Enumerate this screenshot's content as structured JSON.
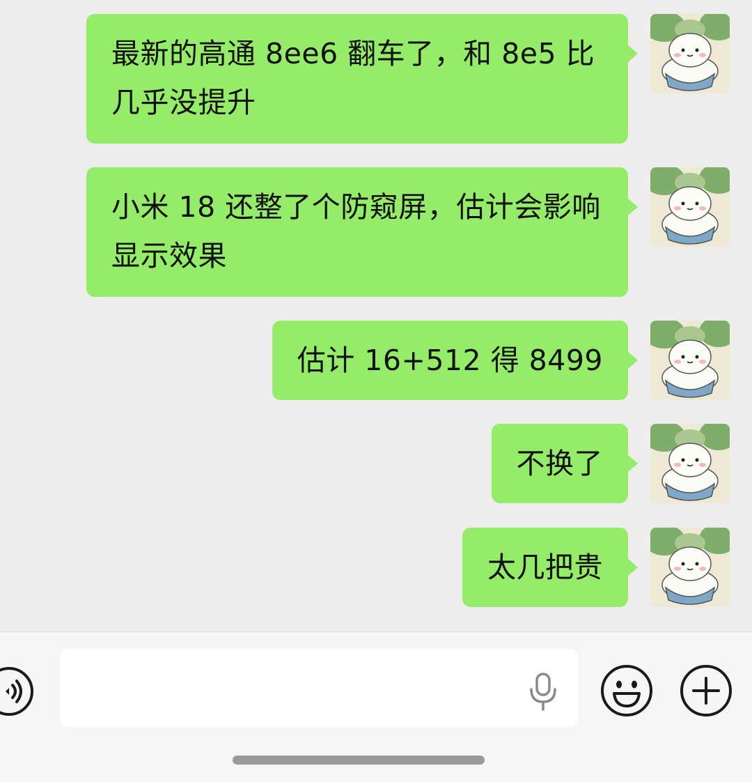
{
  "messages": [
    {
      "text": "最新的高通 8ee6 翻车了，和 8e5 比几乎没提升",
      "sender": "me"
    },
    {
      "text": "小米 18 还整了个防窥屏，估计会影响显示效果",
      "sender": "me"
    },
    {
      "text": "估计 16+512 得 8499",
      "sender": "me"
    },
    {
      "text": "不换了",
      "sender": "me"
    },
    {
      "text": "太几把贵",
      "sender": "me"
    }
  ],
  "input_bar": {
    "message_value": "",
    "icons": [
      "voice-icon",
      "microphone-icon",
      "emoji-icon",
      "plus-icon"
    ]
  },
  "colors": {
    "bubble_sent": "#95ec69",
    "chat_background": "#ededed",
    "input_bar_background": "#f6f6f6"
  }
}
